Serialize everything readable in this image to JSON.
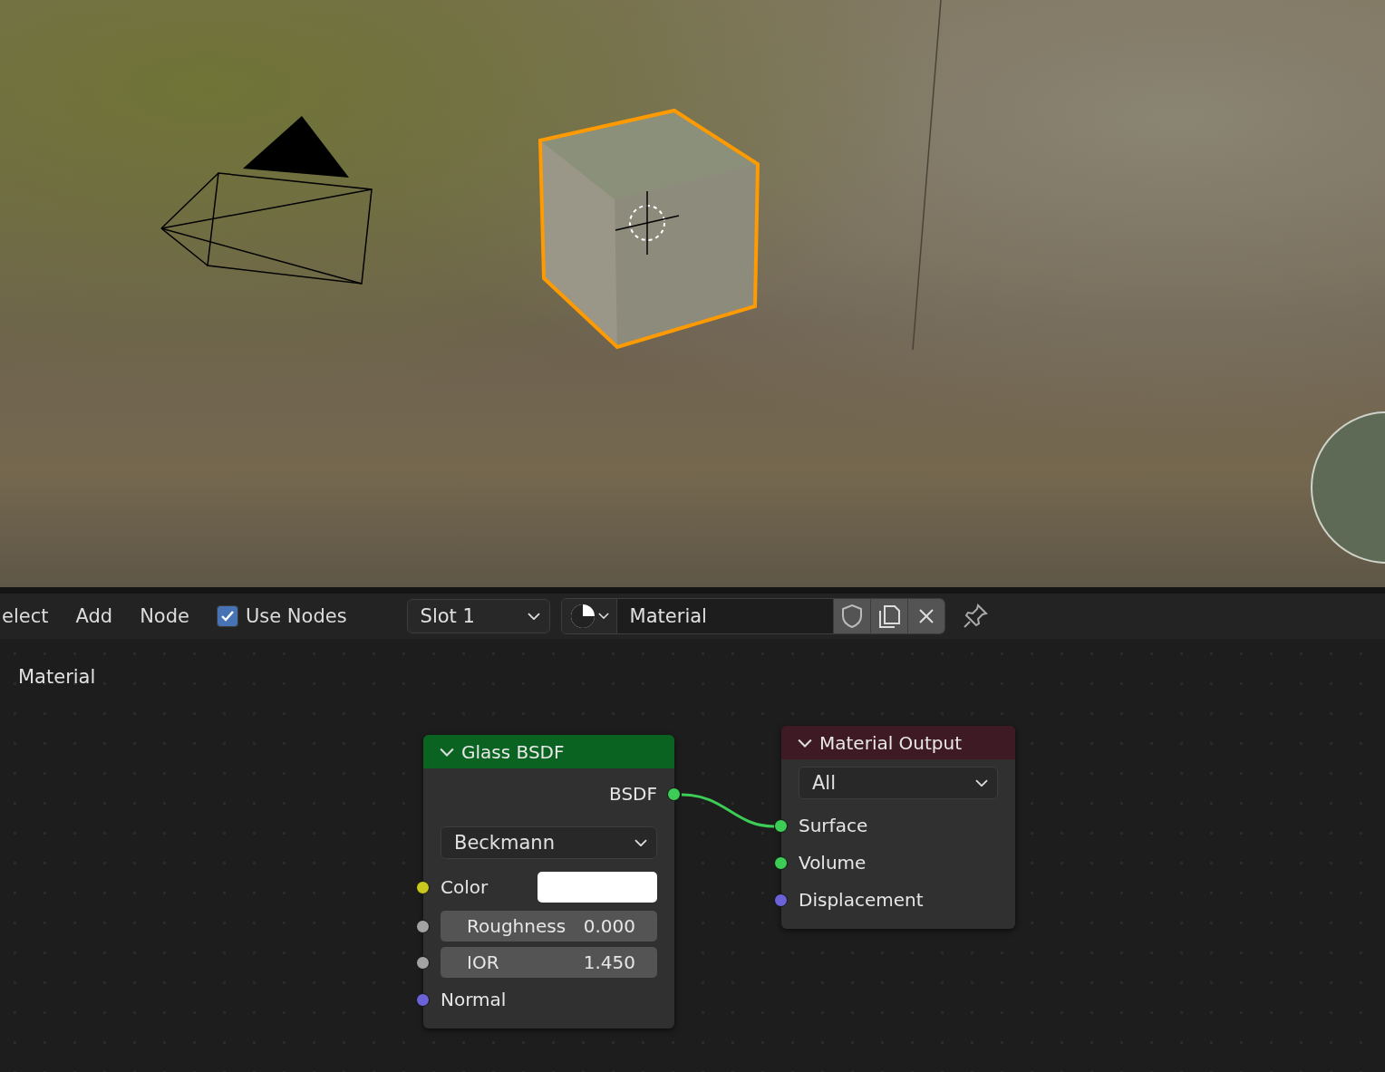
{
  "header": {
    "menus": [
      "elect",
      "Add",
      "Node"
    ],
    "use_nodes": {
      "label": "Use Nodes",
      "checked": true
    },
    "slot": {
      "value": "Slot 1"
    },
    "material": {
      "value": "Material"
    }
  },
  "breadcrumb": "Material",
  "nodes": [
    {
      "title": "Glass BSDF",
      "color": "#0b6322",
      "expanded": true,
      "rows": [
        {
          "kind": "output",
          "label": "BSDF",
          "color": "#3dcc55"
        },
        {
          "kind": "dropdown",
          "value": "Beckmann"
        },
        {
          "kind": "color",
          "label": "Color",
          "color": "#c8c81e",
          "swatch": {
            "color": "#ffffff"
          }
        },
        {
          "kind": "slider",
          "label": "Roughness",
          "value": "0.000",
          "color": "#a3a3a3",
          "level": 0
        },
        {
          "kind": "slider",
          "label": "IOR",
          "value": "1.450",
          "color": "#a3a3a3",
          "level": 0
        },
        {
          "kind": "input",
          "label": "Normal",
          "color": "#6a62d6"
        }
      ]
    },
    {
      "title": "Material Output",
      "color": "#3e1a25",
      "expanded": true,
      "rows": [
        {
          "kind": "dropdown",
          "value": "All"
        },
        {
          "kind": "input",
          "label": "Surface",
          "color": "#3dcc55"
        },
        {
          "kind": "input",
          "label": "Volume",
          "color": "#3dcc55"
        },
        {
          "kind": "input",
          "label": "Displacement",
          "color": "#6a62d6"
        }
      ]
    }
  ]
}
